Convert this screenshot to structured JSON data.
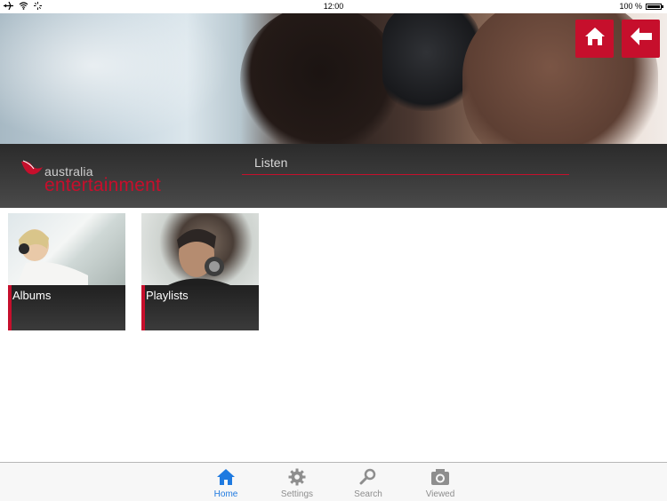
{
  "status_bar": {
    "time": "12:00",
    "battery": "100 %"
  },
  "header": {
    "brand_small": "australia",
    "brand_big": "entertainment",
    "section_title": "Listen"
  },
  "tiles": [
    {
      "label": "Albums"
    },
    {
      "label": "Playlists"
    }
  ],
  "tabbar": {
    "items": [
      {
        "label": "Home"
      },
      {
        "label": "Settings"
      },
      {
        "label": "Search"
      },
      {
        "label": "Viewed"
      }
    ]
  },
  "colors": {
    "accent": "#c60f2c",
    "tab_active": "#1f7ae0",
    "tab_inactive": "#8e8e8e"
  }
}
